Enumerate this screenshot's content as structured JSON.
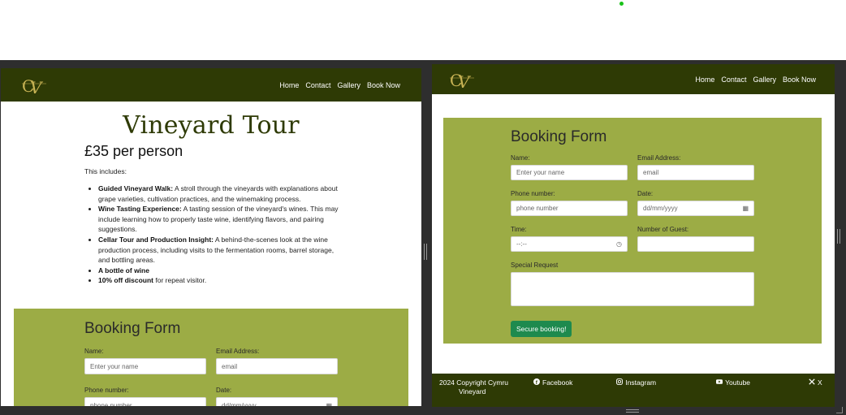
{
  "nav": {
    "home": "Home",
    "contact": "Contact",
    "gallery": "Gallery",
    "book_now": "Book Now"
  },
  "tour": {
    "title": "Vineyard Tour",
    "price": "£35 per person",
    "includes": "This includes:",
    "items": [
      {
        "bold": "Guided Vineyard Walk:",
        "text": " A stroll through the vineyards with explanations about grape varieties, cultivation practices, and the winemaking process."
      },
      {
        "bold": "Wine Tasting Experience:",
        "text": " A tasting session of the vineyard's wines. This may include learning how to properly taste wine, identifying flavors, and pairing suggestions."
      },
      {
        "bold": "Cellar Tour and Production Insight:",
        "text": " A behind-the-scenes look at the wine production process, including visits to the fermentation rooms, barrel storage, and bottling areas."
      },
      {
        "bold": "A bottle of wine",
        "text": ""
      },
      {
        "bold": "10% off discount",
        "text": " for repeat visitor."
      }
    ]
  },
  "form": {
    "title": "Booking Form",
    "name_label": "Name:",
    "name_placeholder": "Enter your name",
    "email_label": "Email Address:",
    "email_placeholder": "email",
    "phone_label": "Phone number:",
    "phone_placeholder": "phone number",
    "date_label": "Date:",
    "date_placeholder": "dd/mm/yyyy",
    "time_label": "Time:",
    "time_placeholder": "--:--",
    "guests_label": "Number of Guest:",
    "request_label": "Special Request",
    "submit": "Secure booking!"
  },
  "footer": {
    "copyright_line1": "2024 Copyright Cymru",
    "copyright_line2": "Vineyard",
    "facebook": "Facebook",
    "instagram": "Instagram",
    "youtube": "Youtube",
    "x": "X"
  },
  "colors": {
    "brand_dark": "#2e3a05",
    "form_green": "#9cac45",
    "button_green": "#1e8a4e",
    "logo_gold": "#c9b455"
  },
  "icons": [
    "logo",
    "facebook-icon",
    "instagram-icon",
    "youtube-icon",
    "x-icon",
    "calendar-icon",
    "clock-icon"
  ]
}
